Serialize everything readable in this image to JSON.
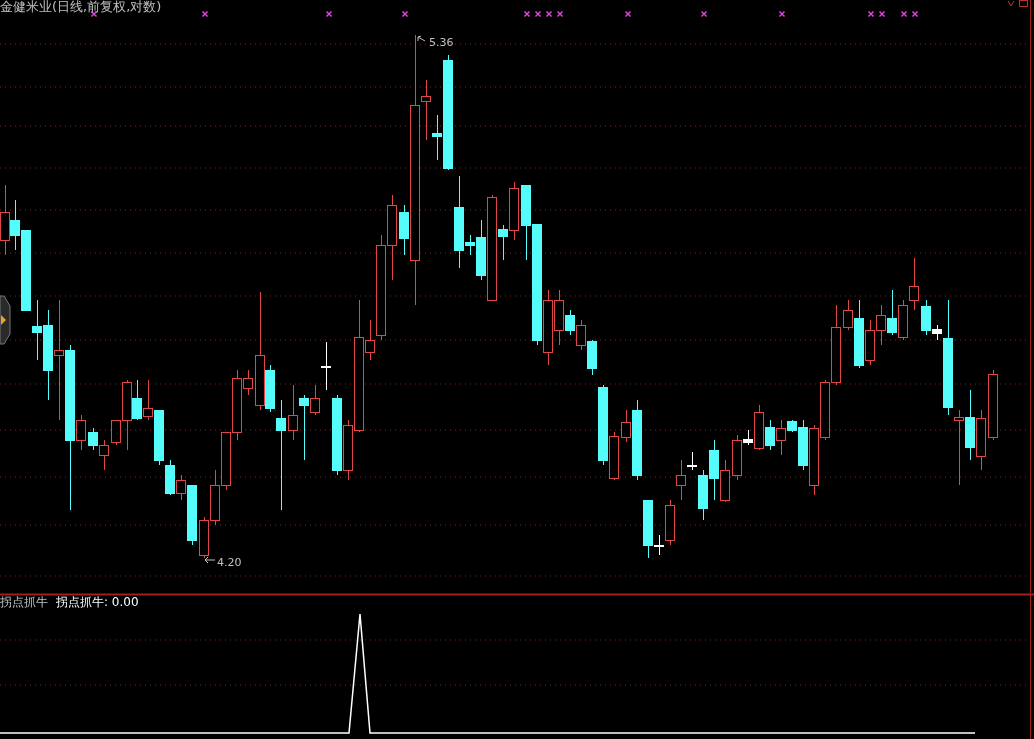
{
  "chart_title": "金健米业(日线,前复权,对数)",
  "price_labels": [
    {
      "kind": "high",
      "text": "5.36"
    },
    {
      "kind": "low",
      "text": "4.20"
    }
  ],
  "indicator": {
    "name": "拐点抓牛",
    "reading": "拐点抓牛: 0.00"
  }
}
